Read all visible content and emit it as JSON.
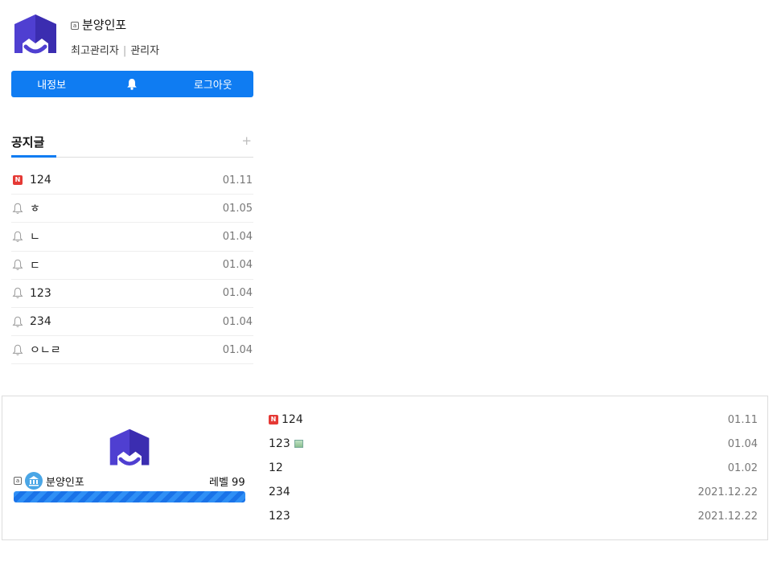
{
  "profile": {
    "name": "분양인포",
    "role": "최고관리자",
    "group": "관리자",
    "buttons": {
      "my_info": "내정보",
      "logout": "로그아웃"
    }
  },
  "notice": {
    "title": "공지글",
    "more": "+",
    "items": [
      {
        "icon": "new-icon",
        "text": "124",
        "date": "01.11"
      },
      {
        "icon": "bell-icon",
        "text": "ㅎ",
        "date": "01.05"
      },
      {
        "icon": "bell-icon",
        "text": "ㄴ",
        "date": "01.04"
      },
      {
        "icon": "bell-icon",
        "text": "ㄷ",
        "date": "01.04"
      },
      {
        "icon": "bell-icon",
        "text": "123",
        "date": "01.04"
      },
      {
        "icon": "bell-icon",
        "text": "234",
        "date": "01.04"
      },
      {
        "icon": "bell-icon",
        "text": "ㅇㄴㄹ",
        "date": "01.04"
      }
    ]
  },
  "widget": {
    "user_name": "분양인포",
    "level": "레벨 99",
    "level_progress": 1.0,
    "recent": [
      {
        "text": "124",
        "date": "01.11",
        "new": true,
        "image": false
      },
      {
        "text": "123",
        "date": "01.04",
        "new": false,
        "image": true
      },
      {
        "text": "12",
        "date": "01.02",
        "new": false,
        "image": false
      },
      {
        "text": "234",
        "date": "2021.12.22",
        "new": false,
        "image": false
      },
      {
        "text": "123",
        "date": "2021.12.22",
        "new": false,
        "image": false
      }
    ]
  },
  "colors": {
    "accent": "#0f7cf2",
    "logo": "#4f3fd1",
    "new_badge": "#e53935"
  }
}
